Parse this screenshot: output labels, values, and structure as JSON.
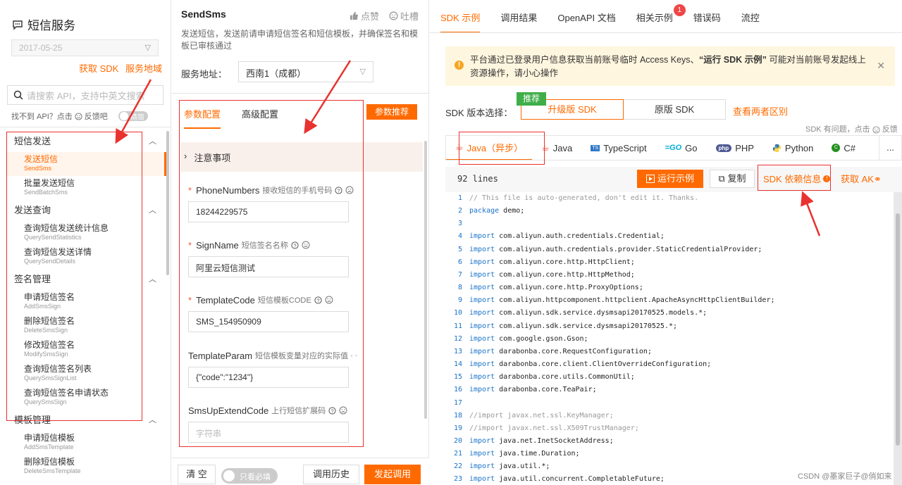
{
  "left": {
    "title": "短信服务",
    "date": "2017-05-25",
    "links": [
      "获取 SDK",
      "服务地域"
    ],
    "search_placeholder": "请搜索 API，支持中英文搜索",
    "noapi_text": "找不到 API？点击",
    "feedback": "反馈吧",
    "toggle_label": "精简",
    "nav": [
      {
        "type": "group",
        "label": "短信发送"
      },
      {
        "type": "item",
        "cn": "发送短信",
        "en": "SendSms",
        "active": true
      },
      {
        "type": "item",
        "cn": "批量发送短信",
        "en": "SendBatchSms"
      },
      {
        "type": "group",
        "label": "发送查询"
      },
      {
        "type": "item",
        "cn": "查询短信发送统计信息",
        "en": "QuerySendStatistics"
      },
      {
        "type": "item",
        "cn": "查询短信发送详情",
        "en": "QuerySendDetails"
      },
      {
        "type": "group",
        "label": "签名管理"
      },
      {
        "type": "item",
        "cn": "申请短信签名",
        "en": "AddSmsSign"
      },
      {
        "type": "item",
        "cn": "删除短信签名",
        "en": "DeleteSmsSign"
      },
      {
        "type": "item",
        "cn": "修改短信签名",
        "en": "ModifySmsSign"
      },
      {
        "type": "item",
        "cn": "查询短信签名列表",
        "en": "QuerySmsSignList"
      },
      {
        "type": "item",
        "cn": "查询短信签名申请状态",
        "en": "QuerySmsSign"
      },
      {
        "type": "group",
        "label": "模板管理"
      },
      {
        "type": "item",
        "cn": "申请短信模板",
        "en": "AddSmsTemplate"
      },
      {
        "type": "item",
        "cn": "删除短信模板",
        "en": "DeleteSmsTemplate"
      }
    ]
  },
  "mid": {
    "api_name": "SendSms",
    "like": "点赞",
    "complain": "吐槽",
    "description": "发送短信，发送前请申请短信签名和短信模板，并确保签名和模板已审核通过",
    "service_label": "服务地址：",
    "region": "西南1（成都）",
    "tabs": [
      "参数配置",
      "高级配置"
    ],
    "recommend_btn": "参数推荐",
    "notice": "注意事项",
    "fields": [
      {
        "name": "PhoneNumbers",
        "desc": "接收短信的手机号码",
        "required": true,
        "value": "18244229575"
      },
      {
        "name": "SignName",
        "desc": "短信签名名称",
        "required": true,
        "value": "阿里云短信测试"
      },
      {
        "name": "TemplateCode",
        "desc": "短信模板CODE",
        "required": true,
        "value": "SMS_154950909"
      },
      {
        "name": "TemplateParam",
        "desc": "短信模板变量对应的实际值",
        "required": false,
        "value": "{\"code\":\"1234\"}"
      },
      {
        "name": "SmsUpExtendCode",
        "desc": "上行短信扩展码",
        "required": false,
        "value": "",
        "placeholder": "字符串"
      }
    ],
    "clear_btn": "清 空",
    "required_only": "只看必填",
    "history_btn": "调用历史",
    "invoke_btn": "发起调用"
  },
  "right": {
    "tabs": [
      "SDK 示例",
      "调用结果",
      "OpenAPI 文档",
      "相关示例",
      "错误码",
      "流控"
    ],
    "badge": "1",
    "warning_1": "平台通过已登录用户信息获取当前账号临时 Access Keys、",
    "warning_bold": "“运行 SDK 示例”",
    "warning_2": " 可能对当前账号发起线上资源操作，请小心操作",
    "sdk_version_label": "SDK 版本选择：",
    "recommended": "推荐",
    "sdk_new": "升级版 SDK",
    "sdk_old": "原版 SDK",
    "compare": "查看两者区别",
    "feedback": "SDK 有问题，点击",
    "feedback_word": "反馈",
    "languages": [
      "Java（异步）",
      "Java",
      "TypeScript",
      "Go",
      "PHP",
      "Python",
      "C#",
      "..."
    ],
    "lines": "92 lines",
    "run_example": "运行示例",
    "copy": "复制",
    "dependency": "SDK 依赖信息",
    "get_ak": "获取 AK",
    "code": [
      {
        "n": "1",
        "t": "// This file is auto-generated, don't edit it. Thanks.",
        "c": "cm"
      },
      {
        "n": "2",
        "k": "package",
        "t": " demo;"
      },
      {
        "n": "3",
        "t": ""
      },
      {
        "n": "4",
        "k": "import",
        "t": " com.aliyun.auth.credentials.Credential;"
      },
      {
        "n": "5",
        "k": "import",
        "t": " com.aliyun.auth.credentials.provider.StaticCredentialProvider;"
      },
      {
        "n": "6",
        "k": "import",
        "t": " com.aliyun.core.http.HttpClient;"
      },
      {
        "n": "7",
        "k": "import",
        "t": " com.aliyun.core.http.HttpMethod;"
      },
      {
        "n": "8",
        "k": "import",
        "t": " com.aliyun.core.http.ProxyOptions;"
      },
      {
        "n": "9",
        "k": "import",
        "t": " com.aliyun.httpcomponent.httpclient.ApacheAsyncHttpClientBuilder;"
      },
      {
        "n": "10",
        "k": "import",
        "t": " com.aliyun.sdk.service.dysmsapi20170525.models.*;"
      },
      {
        "n": "11",
        "k": "import",
        "t": " com.aliyun.sdk.service.dysmsapi20170525.*;"
      },
      {
        "n": "12",
        "k": "import",
        "t": " com.google.gson.Gson;"
      },
      {
        "n": "13",
        "k": "import",
        "t": " darabonba.core.RequestConfiguration;"
      },
      {
        "n": "14",
        "k": "import",
        "t": " darabonba.core.client.ClientOverrideConfiguration;"
      },
      {
        "n": "15",
        "k": "import",
        "t": " darabonba.core.utils.CommonUtil;"
      },
      {
        "n": "16",
        "k": "import",
        "t": " darabonba.core.TeaPair;"
      },
      {
        "n": "17",
        "t": ""
      },
      {
        "n": "18",
        "t": "//import javax.net.ssl.KeyManager;",
        "c": "cm"
      },
      {
        "n": "19",
        "t": "//import javax.net.ssl.X509TrustManager;",
        "c": "cm"
      },
      {
        "n": "20",
        "k": "import",
        "t": " java.net.InetSocketAddress;"
      },
      {
        "n": "21",
        "k": "import",
        "t": " java.time.Duration;"
      },
      {
        "n": "22",
        "k": "import",
        "t": " java.util.*;"
      },
      {
        "n": "23",
        "k": "import",
        "t": " java.util.concurrent.CompletableFuture;"
      }
    ],
    "watermark": "CSDN @墨家巨子@俏如来"
  },
  "colors": {
    "accent": "#ff6a00",
    "annotation": "#e8322f",
    "recommend": "#3fae49"
  }
}
